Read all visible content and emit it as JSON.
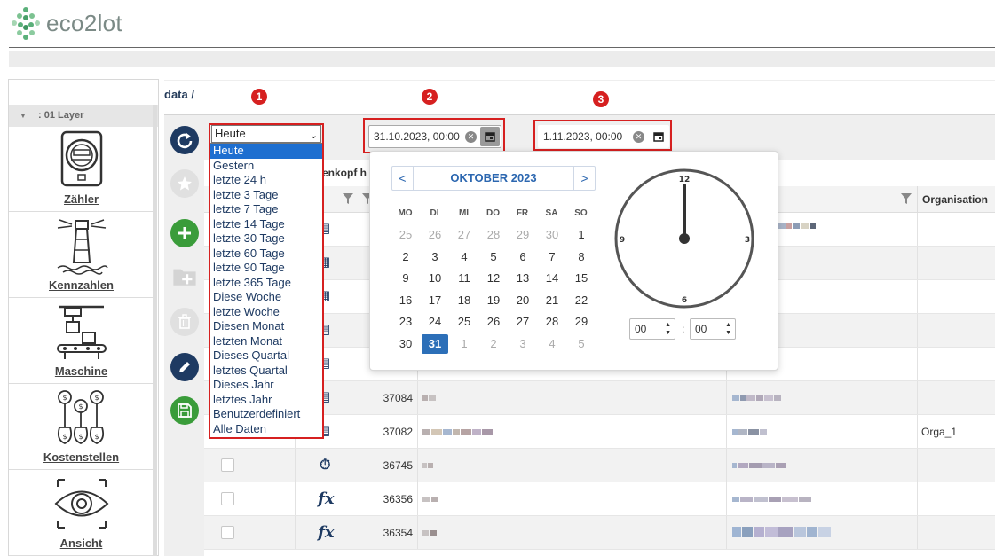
{
  "app": {
    "logo_text": "eco2lot"
  },
  "breadcrumb": "data /",
  "sidebar": {
    "layer_label": ": 01 Layer",
    "items": [
      {
        "label": "Zähler",
        "icon": "meter-icon"
      },
      {
        "label": "Kennzahlen",
        "icon": "lighthouse-icon"
      },
      {
        "label": "Maschine",
        "icon": "machine-icon"
      },
      {
        "label": "Kostenstellen",
        "icon": "money-bags-icon"
      },
      {
        "label": "Ansicht",
        "icon": "eye-icon"
      }
    ]
  },
  "toolbar_icons": [
    "refresh-icon",
    "star-icon",
    "add-icon",
    "folder-add-icon",
    "delete-icon",
    "edit-icon",
    "save-icon"
  ],
  "annotations": [
    "1",
    "2",
    "3"
  ],
  "range_select": {
    "selected": "Heute",
    "options": [
      "Heute",
      "Gestern",
      "letzte 24 h",
      "letzte 3 Tage",
      "letzte 7 Tage",
      "letzte 14 Tage",
      "letzte 30 Tage",
      "letzte 60 Tage",
      "letzte 90 Tage",
      "letzte 365 Tage",
      "Diese Woche",
      "letzte Woche",
      "Diesen Monat",
      "letzten Monat",
      "Dieses Quartal",
      "letztes Quartal",
      "Dieses Jahr",
      "letztes Jahr",
      "Benutzerdefiniert",
      "Alle Daten"
    ]
  },
  "date_from": "31.10.2023, 00:00",
  "date_to": "1.11.2023, 00:00",
  "calendar": {
    "month_label": "OKTOBER 2023",
    "weekdays": [
      "MO",
      "DI",
      "MI",
      "DO",
      "FR",
      "SA",
      "SO"
    ],
    "weeks": [
      [
        {
          "d": "25",
          "o": true
        },
        {
          "d": "26",
          "o": true
        },
        {
          "d": "27",
          "o": true
        },
        {
          "d": "28",
          "o": true
        },
        {
          "d": "29",
          "o": true
        },
        {
          "d": "30",
          "o": true
        },
        {
          "d": "1"
        }
      ],
      [
        {
          "d": "2"
        },
        {
          "d": "3"
        },
        {
          "d": "4"
        },
        {
          "d": "5"
        },
        {
          "d": "6"
        },
        {
          "d": "7"
        },
        {
          "d": "8"
        }
      ],
      [
        {
          "d": "9"
        },
        {
          "d": "10"
        },
        {
          "d": "11"
        },
        {
          "d": "12"
        },
        {
          "d": "13"
        },
        {
          "d": "14"
        },
        {
          "d": "15"
        }
      ],
      [
        {
          "d": "16"
        },
        {
          "d": "17"
        },
        {
          "d": "18"
        },
        {
          "d": "19"
        },
        {
          "d": "20"
        },
        {
          "d": "21"
        },
        {
          "d": "22"
        }
      ],
      [
        {
          "d": "23"
        },
        {
          "d": "24"
        },
        {
          "d": "25"
        },
        {
          "d": "26"
        },
        {
          "d": "27"
        },
        {
          "d": "28"
        },
        {
          "d": "29"
        }
      ],
      [
        {
          "d": "30"
        },
        {
          "d": "31",
          "s": true
        },
        {
          "d": "1",
          "o": true
        },
        {
          "d": "2",
          "o": true
        },
        {
          "d": "3",
          "o": true
        },
        {
          "d": "4",
          "o": true
        },
        {
          "d": "5",
          "o": true
        }
      ]
    ],
    "clock_labels": {
      "top": "12",
      "right": "3",
      "bottom": "6",
      "left": "9"
    },
    "hour": "00",
    "minute": "00",
    "colon": ":"
  },
  "table": {
    "title_fragment": "enkopf h",
    "org_header": "Organisation",
    "rows": [
      {
        "id": "",
        "org": "",
        "icon": "phone-meter-icon"
      },
      {
        "id": "",
        "org": "",
        "icon": "calculator-icon"
      },
      {
        "id": "",
        "org": "",
        "icon": "calculator-icon"
      },
      {
        "id": "",
        "org": "",
        "icon": "phone-meter-icon"
      },
      {
        "id": "",
        "org": "",
        "icon": "phone-meter-icon"
      },
      {
        "id": "37084",
        "org": "",
        "icon": "phone-meter-icon"
      },
      {
        "id": "37082",
        "org": "Orga_1",
        "icon": "phone-meter-icon"
      },
      {
        "id": "36745",
        "org": "",
        "icon": "stopwatch-icon"
      },
      {
        "id": "36356",
        "org": "",
        "icon": "function-icon"
      },
      {
        "id": "36354",
        "org": "",
        "icon": "function-icon"
      }
    ],
    "function_glyph": "fx"
  },
  "colors": {
    "navy": "#1e3a62",
    "green": "#3a9c3a",
    "annotation_red": "#d62020",
    "calendar_blue": "#2c67b0"
  }
}
